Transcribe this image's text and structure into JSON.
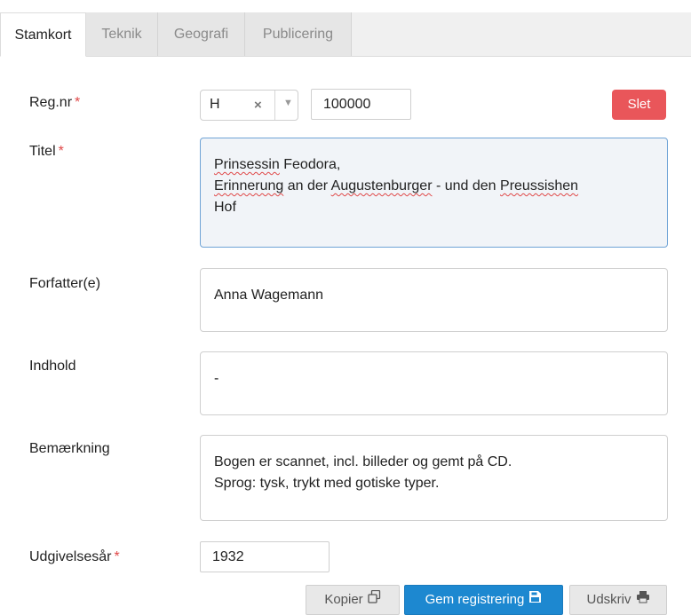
{
  "tabs": [
    {
      "label": "Stamkort",
      "active": true
    },
    {
      "label": "Teknik",
      "active": false
    },
    {
      "label": "Geografi",
      "active": false
    },
    {
      "label": "Publicering",
      "active": false
    }
  ],
  "form": {
    "regnr": {
      "label": "Reg.nr",
      "required_mark": "*",
      "prefix_value": "H",
      "clear_glyph": "×",
      "number_value": "100000",
      "delete_label": "Slet"
    },
    "titel": {
      "label": "Titel",
      "required_mark": "*",
      "line1_word1": "Prinsessin",
      "line1_rest": " Feodora,",
      "line2_word1": "Erinnerung",
      "line2_mid": " an der ",
      "line2_word2": "Augustenburger",
      "line2_mid2": " - und den ",
      "line2_word3": "Preussishen",
      "line3": "Hof"
    },
    "forfatter": {
      "label": "Forfatter(e)",
      "value": "Anna Wagemann"
    },
    "indhold": {
      "label": "Indhold",
      "value": "-"
    },
    "bemaerkning": {
      "label": "Bemærkning",
      "line1": "Bogen er scannet, incl. billeder og gemt på CD.",
      "line2": "Sprog: tysk, trykt med gotiske typer."
    },
    "udgivelsesaar": {
      "label": "Udgivelsesår",
      "required_mark": "*",
      "value": "1932"
    }
  },
  "actions": {
    "copy_label": "Kopier",
    "save_label": "Gem registrering",
    "print_label": "Udskriv"
  },
  "colors": {
    "danger": "#e9565a",
    "primary": "#1d88d0",
    "required": "#e04848"
  },
  "icons": {
    "copy": "copy-icon",
    "save": "floppy-disk-icon",
    "print": "printer-icon",
    "clear": "clear-icon",
    "caret": "caret-down-icon"
  }
}
